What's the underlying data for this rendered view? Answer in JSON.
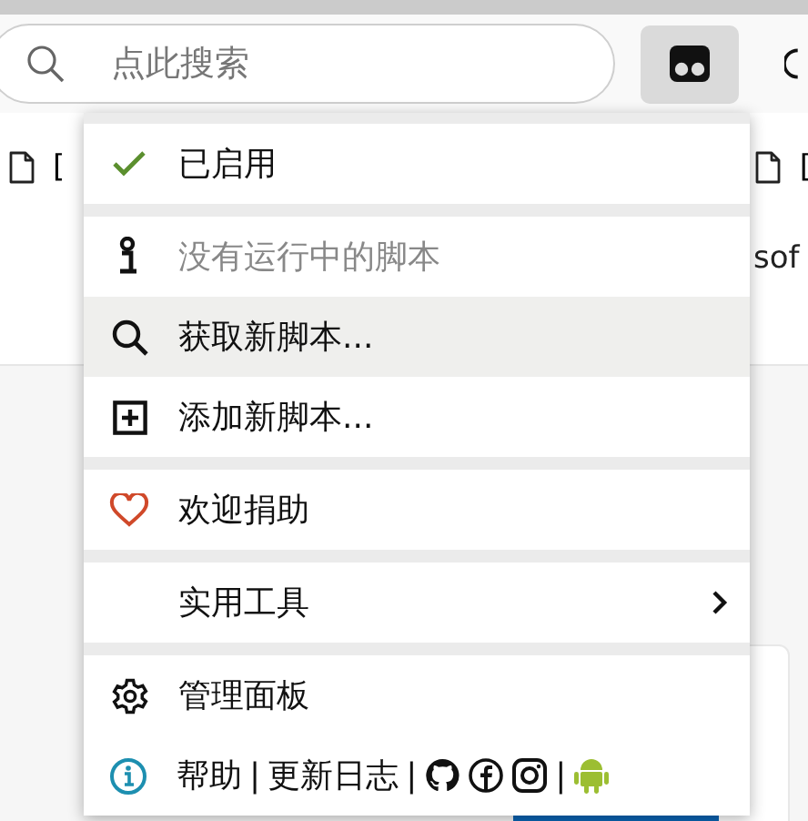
{
  "toolbar": {
    "search": {
      "placeholder": "点此搜索"
    }
  },
  "bookmarks": [
    {
      "text": "["
    },
    {
      "text": "["
    }
  ],
  "page": {
    "fragment": "sof"
  },
  "menu": {
    "sections": [
      {
        "items": [
          {
            "kind": "check",
            "label": "已启用",
            "checked": true,
            "disabled": false,
            "selected": false
          }
        ]
      },
      {
        "items": [
          {
            "kind": "info",
            "label": "没有运行中的脚本",
            "disabled": true,
            "selected": false
          },
          {
            "kind": "search",
            "label": "获取新脚本...",
            "disabled": false,
            "selected": true
          },
          {
            "kind": "add",
            "label": "添加新脚本...",
            "disabled": false,
            "selected": false
          }
        ]
      },
      {
        "items": [
          {
            "kind": "heart",
            "label": "欢迎捐助",
            "disabled": false,
            "selected": false
          }
        ]
      },
      {
        "items": [
          {
            "kind": "submenu",
            "label": "实用工具",
            "disabled": false,
            "selected": false
          }
        ]
      },
      {
        "items": [
          {
            "kind": "gear",
            "label": "管理面板",
            "disabled": false,
            "selected": false
          },
          {
            "kind": "links",
            "parts": [
              {
                "kind": "link",
                "text": "帮助"
              },
              {
                "kind": "sep",
                "text": "|"
              },
              {
                "kind": "link",
                "text": "更新日志"
              },
              {
                "kind": "sep",
                "text": "|"
              },
              {
                "kind": "github"
              },
              {
                "kind": "facebook"
              },
              {
                "kind": "instagram"
              },
              {
                "kind": "sep",
                "text": "|"
              },
              {
                "kind": "android"
              }
            ]
          }
        ]
      }
    ]
  }
}
